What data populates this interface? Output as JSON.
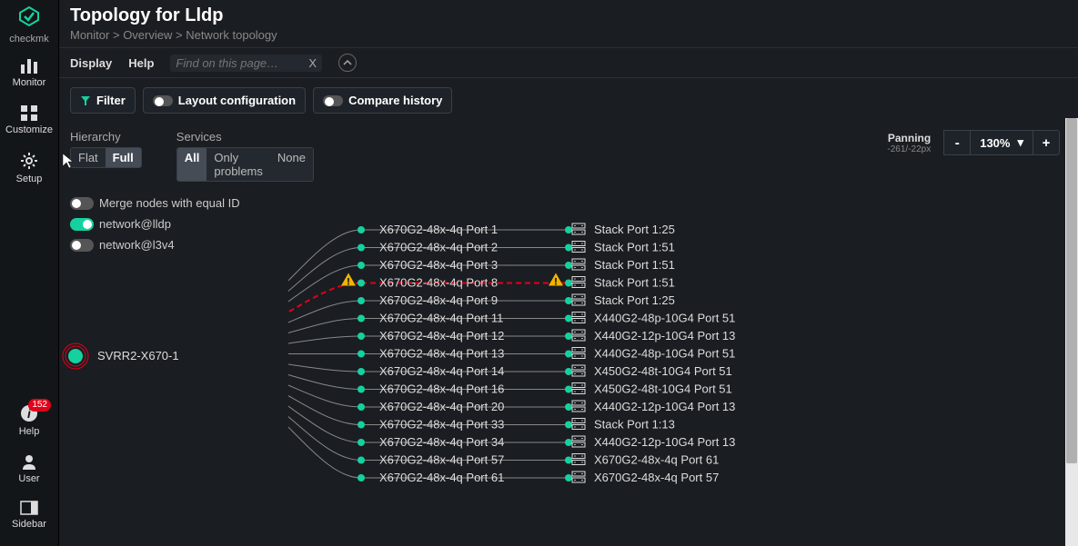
{
  "brand": "checkmk",
  "nav": [
    {
      "label": "Monitor",
      "icon": "bars"
    },
    {
      "label": "Customize",
      "icon": "grid"
    },
    {
      "label": "Setup",
      "icon": "gear"
    }
  ],
  "bottom": [
    {
      "label": "Help",
      "icon": "info",
      "badge": "152"
    },
    {
      "label": "User",
      "icon": "user"
    },
    {
      "label": "Sidebar",
      "icon": "panel"
    }
  ],
  "page_title": "Topology for Lldp",
  "breadcrumb": [
    "Monitor",
    "Overview",
    "Network topology"
  ],
  "menubar": {
    "items": [
      "Display",
      "Help"
    ],
    "search_placeholder": "Find on this page…"
  },
  "toolbar": {
    "filter": "Filter",
    "layout": "Layout configuration",
    "compare": "Compare history"
  },
  "options": {
    "hierarchy": {
      "label": "Hierarchy",
      "items": [
        "Flat",
        "Full"
      ],
      "active": 1
    },
    "services": {
      "label": "Services",
      "items": [
        "All",
        "Only problems",
        "None"
      ],
      "active": 0
    },
    "toggles": [
      {
        "label": "Merge nodes with equal ID",
        "on": false
      },
      {
        "label": "network@lldp",
        "on": true
      },
      {
        "label": "network@l3v4",
        "on": false
      }
    ]
  },
  "zoom": {
    "panning_label": "Panning",
    "panning_val": "-261/-22px",
    "value": "130%"
  },
  "root_node": "SVRR2-X670-1",
  "rows": [
    {
      "left": "X670G2-48x-4q Port 1",
      "right": "Stack Port 1:25"
    },
    {
      "left": "X670G2-48x-4q Port 2",
      "right": "Stack Port 1:51"
    },
    {
      "left": "X670G2-48x-4q Port 3",
      "right": "Stack Port 1:51"
    },
    {
      "left": "X670G2-48x-4q Port 8",
      "right": "Stack Port 1:51",
      "warn": true
    },
    {
      "left": "X670G2-48x-4q Port 9",
      "right": "Stack Port 1:25"
    },
    {
      "left": "X670G2-48x-4q Port 11",
      "right": "X440G2-48p-10G4 Port 51"
    },
    {
      "left": "X670G2-48x-4q Port 12",
      "right": "X440G2-12p-10G4 Port 13"
    },
    {
      "left": "X670G2-48x-4q Port 13",
      "right": "X440G2-48p-10G4 Port 51"
    },
    {
      "left": "X670G2-48x-4q Port 14",
      "right": "X450G2-48t-10G4 Port 51"
    },
    {
      "left": "X670G2-48x-4q Port 16",
      "right": "X450G2-48t-10G4 Port 51"
    },
    {
      "left": "X670G2-48x-4q Port 20",
      "right": "X440G2-12p-10G4 Port 13"
    },
    {
      "left": "X670G2-48x-4q Port 33",
      "right": "Stack Port 1:13"
    },
    {
      "left": "X670G2-48x-4q Port 34",
      "right": "X440G2-12p-10G4 Port 13"
    },
    {
      "left": "X670G2-48x-4q Port 57",
      "right": "X670G2-48x-4q Port 61"
    },
    {
      "left": "X670G2-48x-4q Port 61",
      "right": "X670G2-48x-4q Port 57"
    }
  ]
}
